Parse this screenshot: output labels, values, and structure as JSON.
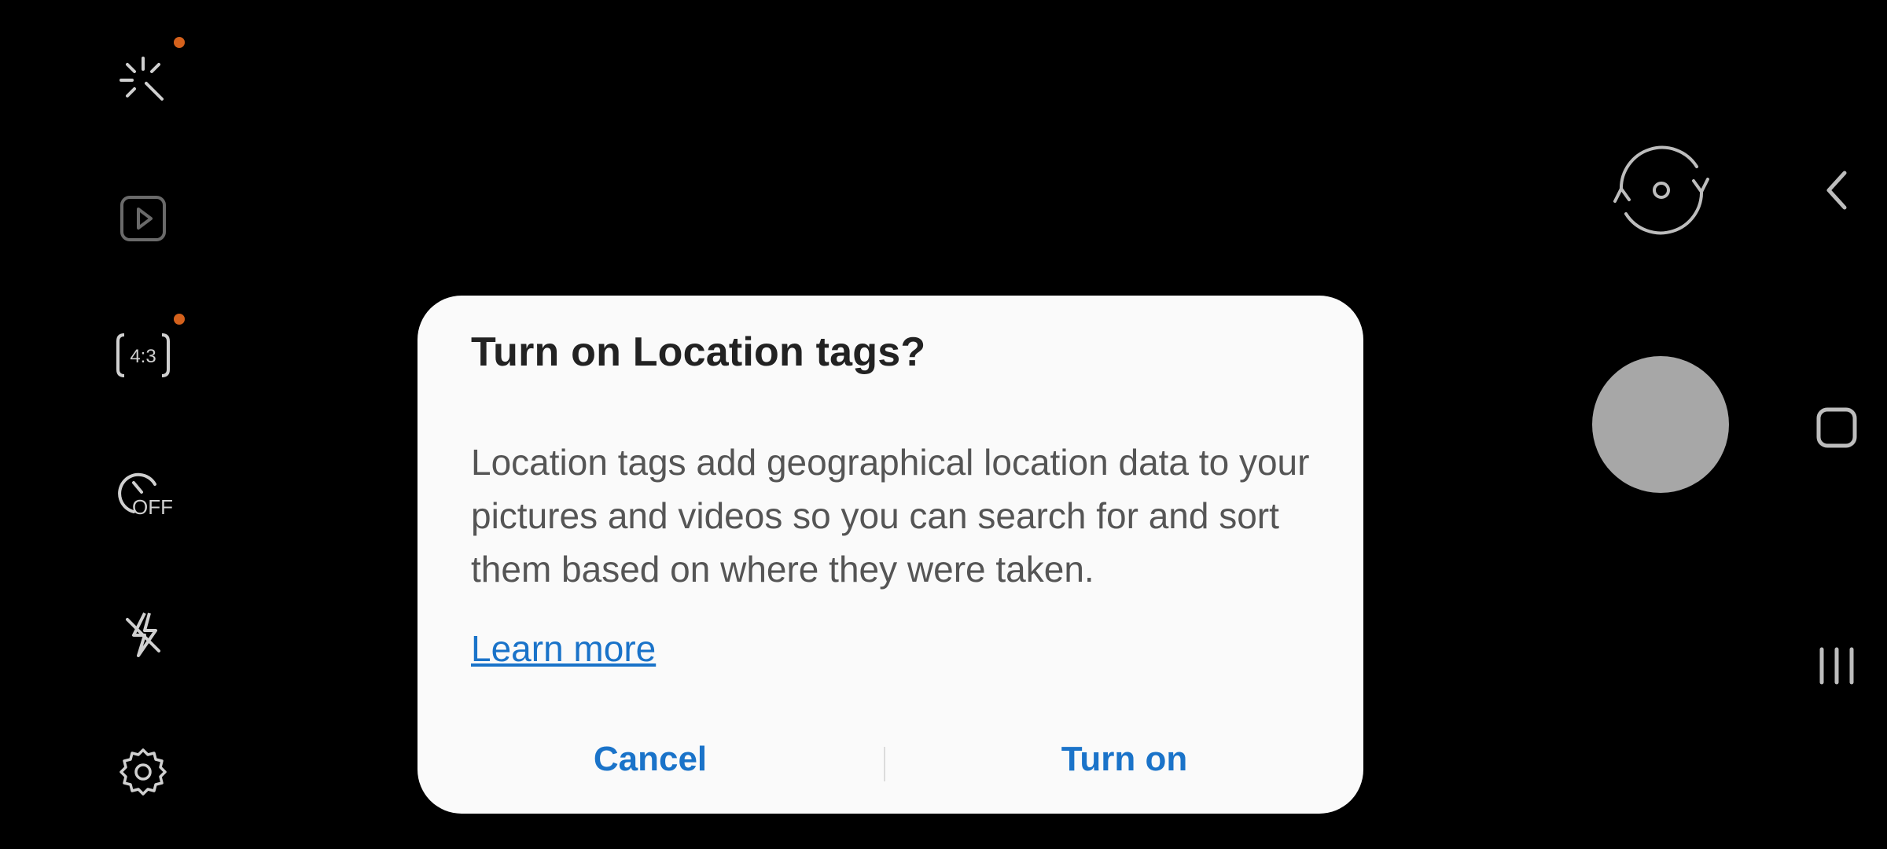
{
  "left_toolbar": {
    "icons": [
      "effects-icon",
      "motion-photo-icon",
      "aspect-ratio-icon",
      "timer-icon",
      "flash-off-icon",
      "settings-icon"
    ],
    "aspect_ratio_label": "4:3",
    "timer_label": "OFF",
    "badge_color": "#d4611c"
  },
  "dialog": {
    "title": "Turn on Location tags?",
    "body": "Location tags add geographical location data to your pictures and videos so you can search for and sort them based on where they were taken.",
    "learn_more": "Learn more",
    "cancel_label": "Cancel",
    "confirm_label": "Turn on",
    "accent_color": "#1a73c9"
  },
  "right_controls": {
    "icons": [
      "switch-camera-icon",
      "shutter-button"
    ]
  },
  "nav_bar": {
    "icons": [
      "back-icon",
      "home-icon",
      "recents-icon"
    ]
  }
}
